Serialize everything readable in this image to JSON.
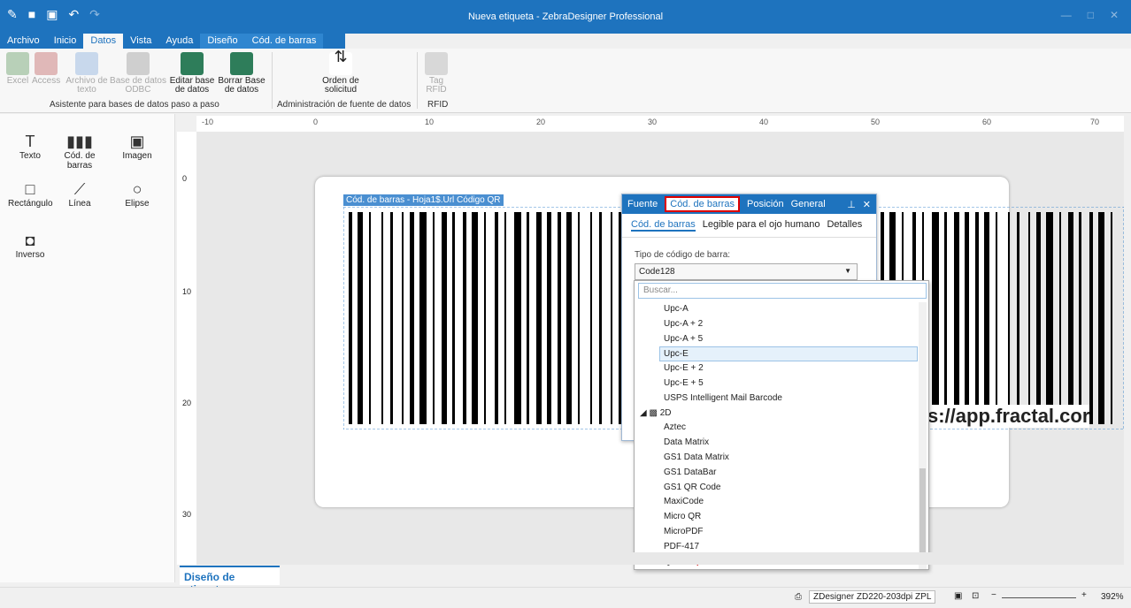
{
  "window": {
    "title": "Nueva etiqueta - ZebraDesigner Professional"
  },
  "ribbon_tabs": [
    "Archivo",
    "Inicio",
    "Datos",
    "Vista",
    "Ayuda",
    "Diseño",
    "Cód. de barras"
  ],
  "ribbon": {
    "buttons": [
      {
        "label": "Excel",
        "enabled": false
      },
      {
        "label": "Access",
        "enabled": false
      },
      {
        "label": "Archivo de texto",
        "enabled": false
      },
      {
        "label": "Base de datos ODBC",
        "enabled": false
      },
      {
        "label": "Editar base de datos",
        "enabled": true
      },
      {
        "label": "Borrar Base de datos",
        "enabled": true
      },
      {
        "label": "Orden de solicitud",
        "enabled": true
      },
      {
        "label": "Tag RFID",
        "enabled": false
      }
    ],
    "groups": [
      "Asistente para bases de datos paso a paso",
      "Administración de fuente de datos",
      "RFID"
    ]
  },
  "toolbox": [
    "Texto",
    "Cód. de barras",
    "Imagen",
    "Rectángulo",
    "Línea",
    "Elipse",
    "Inverso"
  ],
  "ruler": {
    "h_ticks": [
      "-10",
      "0",
      "10",
      "20",
      "30",
      "40",
      "50",
      "60",
      "70"
    ],
    "v_ticks": [
      "0",
      "10",
      "20",
      "30"
    ]
  },
  "canvas": {
    "object_tag": "Cód. de barras - Hoja1$.Url Código QR",
    "url_text": "s://app.fractal.cor"
  },
  "panel": {
    "tabs": [
      "Fuente",
      "Cód. de barras",
      "Posición",
      "General"
    ],
    "active_tab": "Cód. de barras",
    "subtabs": [
      "Cód. de barras",
      "Legible para el ojo humano",
      "Detalles"
    ],
    "type_label": "Tipo de código de barra:",
    "type_value": "Code128"
  },
  "dropdown": {
    "search_placeholder": "Buscar...",
    "items": [
      "Upc-A",
      "Upc-A + 2",
      "Upc-A + 5",
      "Upc-E",
      "Upc-E + 2",
      "Upc-E + 5",
      "USPS Intelligent Mail Barcode",
      "2D",
      "Aztec",
      "Data Matrix",
      "GS1 Data Matrix",
      "GS1 DataBar",
      "GS1 QR Code",
      "MaxiCode",
      "Micro QR",
      "MicroPDF",
      "PDF-417",
      "QR"
    ],
    "highlighted": "Upc-E"
  },
  "bottom_tab": "Diseño de etiqueta",
  "status": {
    "printer": "ZDesigner ZD220-203dpi ZPL",
    "zoom": "392%"
  },
  "colors": {
    "accent": "#1e73be",
    "highlight": "#d00000"
  }
}
